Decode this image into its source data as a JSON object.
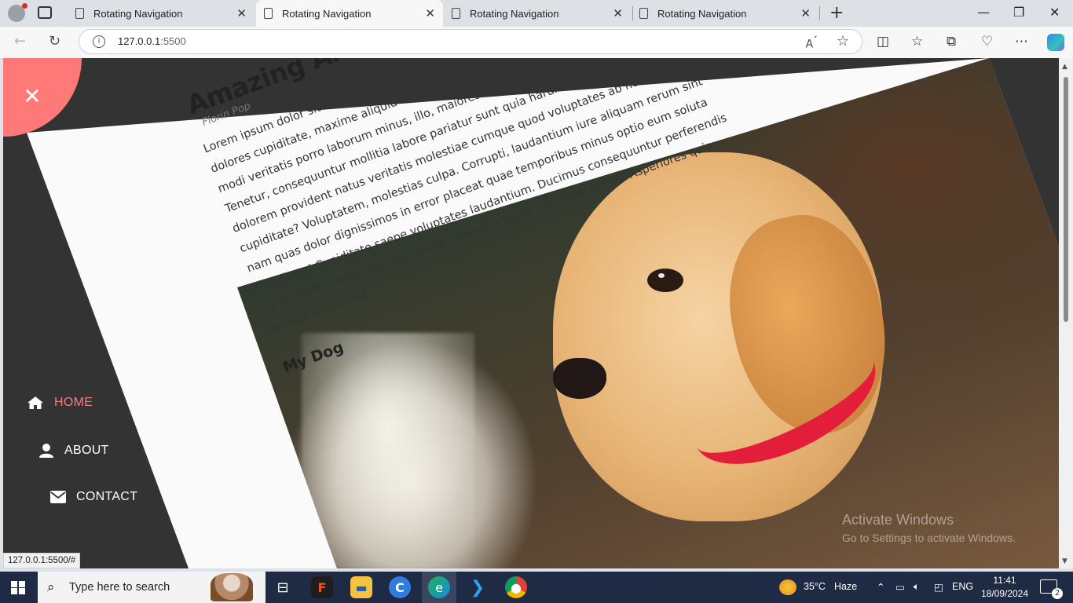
{
  "browser": {
    "tabs": [
      {
        "title": "Rotating Navigation"
      },
      {
        "title": "Rotating Navigation"
      },
      {
        "title": "Rotating Navigation"
      },
      {
        "title": "Rotating Navigation"
      }
    ],
    "address": {
      "host": "127.0.0.1",
      "port": ":5500"
    },
    "status_url": "127.0.0.1:5500/#"
  },
  "page": {
    "title": "Amazing Ar",
    "author": "Florin Pop",
    "body": "Lorem ipsum dolor sit amet consectetur adipisicing elit. Accusantium quia in ratione dolores cupiditate, maxime aliquid impedit dolorem nam dolor omnis atque fuga labore modi veritatis porro laborum minus, illo, maiores recusandae cumque ipsa quos. Tenetur, consequuntur mollitia labore pariatur sunt quia harum aut. Eum maxime dolorem provident natus veritatis molestiae cumque quod voluptates ab non, tempore cupiditate? Voluptatem, molestias culpa. Corrupti, laudantium iure aliquam rerum sint nam quas dolor dignissimos in error placeat quae temporibus minus optio eum soluta cupiditate! Cupiditate saepe voluptates laudantium. Ducimus consequuntur perferendis consequatur nobis exercitationem molestias fugiat commodi omnis. Asperiores quia tenetur nemo ipsa.",
    "subheading": "My Dog",
    "accent_color": "#ff7979"
  },
  "nav": {
    "items": [
      {
        "label": "Home",
        "icon": "home-icon",
        "active": true
      },
      {
        "label": "About",
        "icon": "user-icon",
        "active": false
      },
      {
        "label": "Contact",
        "icon": "envelope-icon",
        "active": false
      }
    ]
  },
  "watermark": {
    "line1": "Activate Windows",
    "line2": "Go to Settings to activate Windows."
  },
  "taskbar": {
    "search_placeholder": "Type here to search",
    "weather": "35°C",
    "weather_desc": "Haze",
    "lang": "ENG",
    "time": "11:41",
    "date": "18/09/2024",
    "notifications": "2"
  }
}
